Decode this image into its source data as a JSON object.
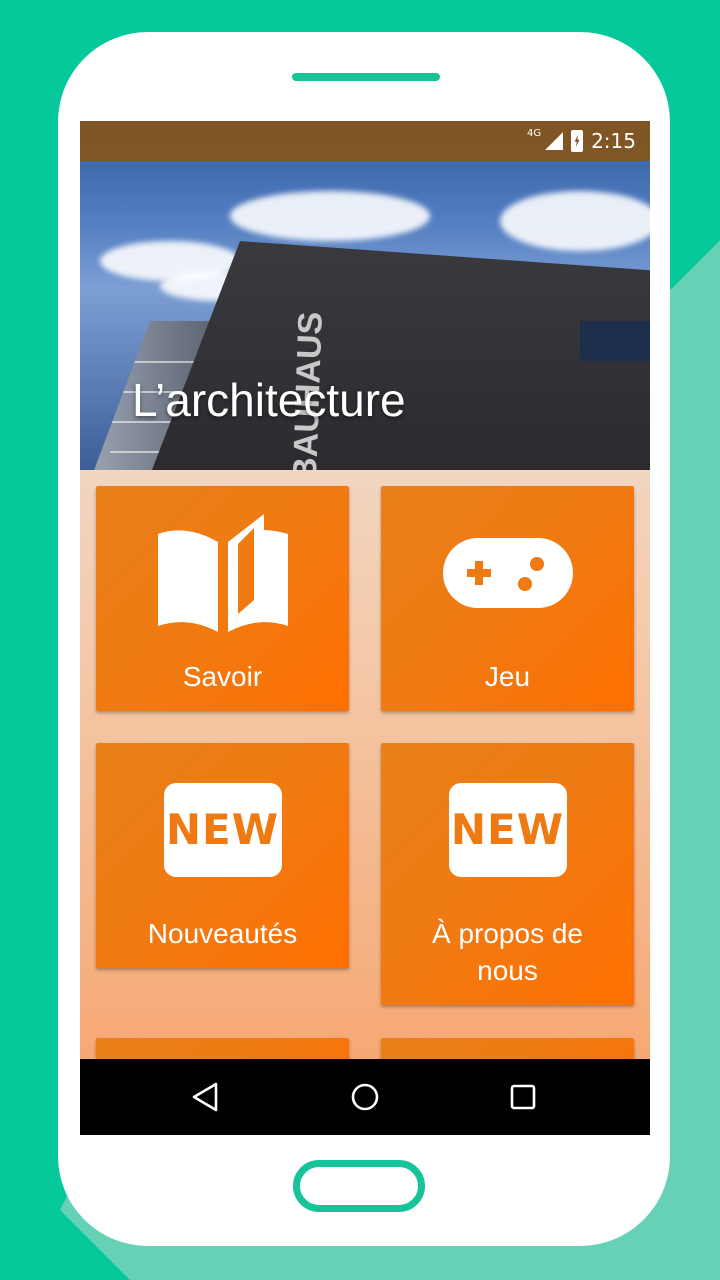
{
  "status_bar": {
    "network": "4G",
    "time": "2:15"
  },
  "hero": {
    "title": "L’architecture",
    "building_lettering": "BAUHAUS"
  },
  "tiles": [
    {
      "label": "Savoir",
      "icon": "open-book-icon"
    },
    {
      "label": "Jeu",
      "icon": "gamepad-icon"
    },
    {
      "label": "Nouveautés",
      "icon": "new-badge-icon",
      "badge_text": "NEW"
    },
    {
      "label_line1": "À propos de",
      "label_line2": "nous",
      "icon": "new-badge-icon",
      "badge_text": "NEW"
    }
  ],
  "navbar": {
    "icons": [
      "back-icon",
      "home-icon",
      "recents-icon"
    ]
  },
  "colors": {
    "background": "#05c99a",
    "tile_orange": "#f07a12",
    "phone_accent": "#18c39a"
  }
}
